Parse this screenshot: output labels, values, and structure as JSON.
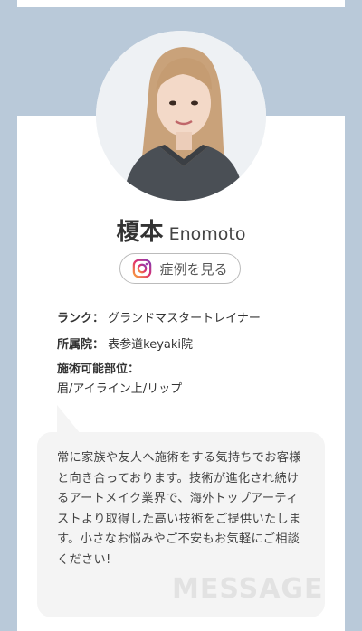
{
  "profile": {
    "name_ja": "榎本",
    "name_en": "Enomoto",
    "instagram_label": "症例を見る"
  },
  "details": {
    "rank_key": "ランク：",
    "rank_value": "グランドマスタートレイナー",
    "clinic_key": "所属院：",
    "clinic_value": "表参道keyaki院",
    "areas_key": "施術可能部位：",
    "areas_value": "眉/アイライン上/リップ"
  },
  "message": {
    "text": "常に家族や友人へ施術をする気持ちでお客様と向き合っております。技術が進化され続けるアートメイク業界で、海外トップアーティストより取得した高い技術をご提供いたします。小さなお悩みやご不安もお気軽にご相談ください!",
    "watermark": "MESSAGE"
  },
  "icons": {
    "instagram": "instagram-icon"
  },
  "colors": {
    "background": "#b9c9d9",
    "card": "#ffffff",
    "bubble": "#f4f4f4"
  }
}
